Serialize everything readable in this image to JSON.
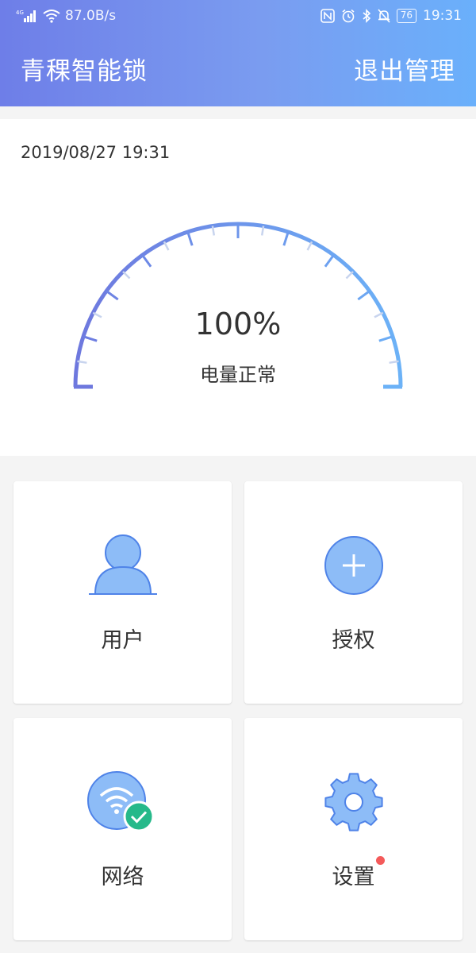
{
  "status_bar": {
    "network_type": "4G",
    "speed": "87.0B/s",
    "battery": "76",
    "time": "19:31"
  },
  "header": {
    "title": "青稞智能锁",
    "exit_label": "退出管理"
  },
  "gauge": {
    "datetime": "2019/08/27 19:31",
    "percent_text": "100%",
    "percent_value": 100,
    "status_text": "电量正常"
  },
  "cards": {
    "users": {
      "label": "用户",
      "icon": "user-icon"
    },
    "authorize": {
      "label": "授权",
      "icon": "plus-circle-icon"
    },
    "network": {
      "label": "网络",
      "icon": "wifi-check-icon"
    },
    "settings": {
      "label": "设置",
      "icon": "gear-icon",
      "has_notification": true
    }
  },
  "colors": {
    "header_gradient_start": "#6e7ee8",
    "header_gradient_end": "#6ab0fb",
    "icon_fill": "#8dbcf7",
    "icon_stroke": "#4f83e8",
    "check_badge": "#26b98a",
    "notification_dot": "#f45a5a"
  }
}
